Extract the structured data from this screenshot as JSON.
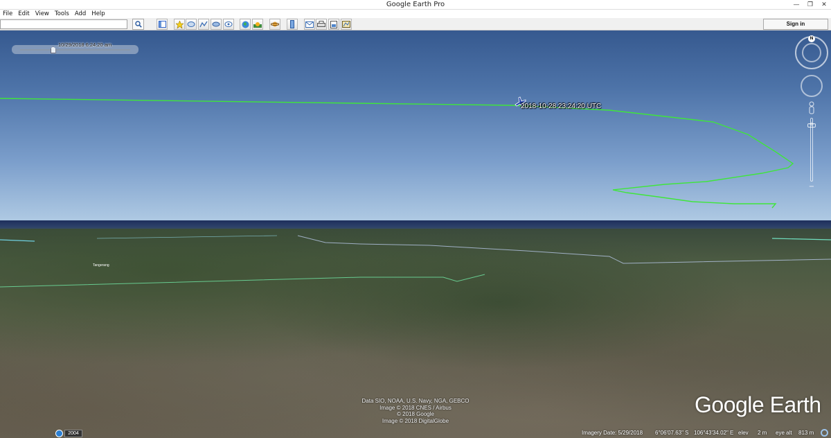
{
  "window": {
    "title": "Google Earth Pro",
    "min": "—",
    "max": "❐",
    "close": "✕"
  },
  "menu": [
    {
      "label": "File",
      "key": "F"
    },
    {
      "label": "Edit",
      "key": "E"
    },
    {
      "label": "View",
      "key": "V"
    },
    {
      "label": "Tools",
      "key": "T"
    },
    {
      "label": "Add",
      "key": "A"
    },
    {
      "label": "Help",
      "key": "H"
    }
  ],
  "toolbar": {
    "search_value": "",
    "sign_in_label": "Sign in",
    "icons": [
      "sidebar-toggle-icon",
      "placemark-icon",
      "polygon-icon",
      "path-icon",
      "overlay-icon",
      "tour-icon",
      "historical-imagery-icon",
      "sunlight-icon",
      "planets-icon",
      "ruler-icon",
      "email-icon",
      "print-icon",
      "save-image-icon",
      "maps-icon"
    ]
  },
  "time_slider": {
    "label": "10/29/2018  6:24:20 am",
    "position": 0.3
  },
  "placemark": {
    "label": "2018-10-28 23:24:20 UTC",
    "icon": "airplane-icon"
  },
  "navigation": {
    "north_label": "N",
    "zoom_in": "+",
    "zoom_out": "−",
    "zoom_level": 0.05
  },
  "map_labels": {
    "town": "Tangerang"
  },
  "attribution": {
    "lines": [
      "Data SIO, NOAA, U.S. Navy, NGA, GEBCO",
      "Image © 2018 CNES / Airbus",
      "© 2018 Google",
      "Image © 2018 DigitalGlobe"
    ]
  },
  "logo": "Google Earth",
  "status": {
    "year": "2004",
    "imagery_date": "Imagery Date: 5/29/2018",
    "lat": "6°06'07.63\" S",
    "lon": "106°43'34.02\" E",
    "elev_label": "elev",
    "elev_value": "2 m",
    "eye_alt_label": "eye alt",
    "eye_alt_value": "813 m"
  },
  "colors": {
    "track": "#3fe63a",
    "sky_top": "#36598f",
    "horizon": "#e9f3fa"
  }
}
